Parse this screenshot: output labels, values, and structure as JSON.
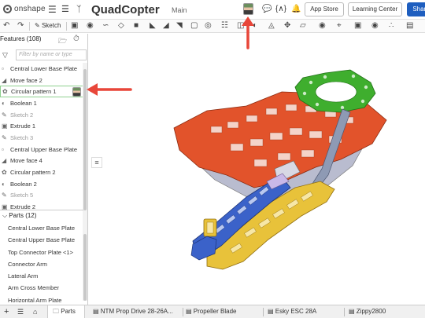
{
  "header": {
    "logo_text": "onshape",
    "doc_title": "QuadCopter",
    "branch": "Main",
    "app_store": "App Store",
    "learning_center": "Learning Center",
    "share": "Share",
    "icons": [
      "menu-icon",
      "tasks-icon",
      "branch-icon",
      "chat-icon",
      "code-icon",
      "bell-icon"
    ]
  },
  "toolbar": {
    "sketch_label": "Sketch",
    "icons": [
      "undo-icon",
      "redo-icon",
      "sketch-icon",
      "extrude-icon",
      "revolve-icon",
      "sweep-icon",
      "loft-icon",
      "thicken-icon",
      "fillet-icon",
      "chamfer-icon",
      "draft-icon",
      "shell-icon",
      "hole-icon",
      "pattern-icon",
      "mirror-icon",
      "boolean-icon",
      "split-icon",
      "transform-icon",
      "plane-icon",
      "mate-icon",
      "measure-icon",
      "section-icon",
      "view-icon"
    ]
  },
  "features": {
    "header": "Features (108)",
    "filter_placeholder": "Filter by name or type",
    "items": [
      {
        "label": "Central Lower Base Plate",
        "icon": "part-icon",
        "state": "normal"
      },
      {
        "label": "Move face 2",
        "icon": "move-face-icon",
        "state": "normal"
      },
      {
        "label": "Circular pattern 1",
        "icon": "circular-pattern-icon",
        "state": "selected"
      },
      {
        "label": "Boolean 1",
        "icon": "boolean-icon",
        "state": "normal"
      },
      {
        "label": "Sketch 2",
        "icon": "sketch-icon",
        "state": "dim"
      },
      {
        "label": "Extrude 1",
        "icon": "extrude-icon",
        "state": "normal"
      },
      {
        "label": "Sketch 3",
        "icon": "sketch-icon",
        "state": "dim"
      },
      {
        "label": "Central Upper Base Plate",
        "icon": "part-icon",
        "state": "normal"
      },
      {
        "label": "Move face 4",
        "icon": "move-face-icon",
        "state": "normal"
      },
      {
        "label": "Circular pattern 2",
        "icon": "circular-pattern-icon",
        "state": "normal"
      },
      {
        "label": "Boolean 2",
        "icon": "boolean-icon",
        "state": "normal"
      },
      {
        "label": "Sketch 5",
        "icon": "sketch-icon",
        "state": "dim"
      },
      {
        "label": "Extrude 2",
        "icon": "extrude-icon",
        "state": "normal"
      }
    ]
  },
  "parts": {
    "header": "Parts (12)",
    "items": [
      "Central Lower Base Plate",
      "Central Upper Base Plate",
      "Top Connector Plate <1>",
      "Connector Arm",
      "Lateral Arm",
      "Arm Cross Member",
      "Horizontal Arm Plate"
    ]
  },
  "tabs": {
    "items": [
      {
        "label": "Parts",
        "active": true
      },
      {
        "label": "NTM Prop Drive 28-26A...",
        "active": false
      },
      {
        "label": "Propeller Blade",
        "active": false
      },
      {
        "label": "Esky ESC 28A",
        "active": false
      },
      {
        "label": "Zippy2800",
        "active": false
      }
    ]
  },
  "colors": {
    "annotation_red": "#e8473a",
    "plate_orange": "#e2532b",
    "plate_gray": "#b9bccf",
    "plate_green": "#3fae2e",
    "arm_yellow": "#e8c23a",
    "arm_blue": "#3b62c9",
    "connector_slate": "#8e9ab4",
    "accent_blue": "#1e5ebf"
  }
}
